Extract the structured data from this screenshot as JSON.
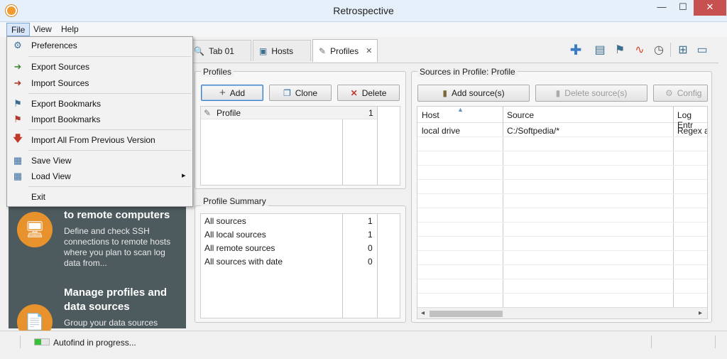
{
  "window": {
    "title": "Retrospective",
    "controls": {
      "minimize": "—",
      "maximize": "☐",
      "close": "✕"
    }
  },
  "menubar": {
    "file": "File",
    "view": "View",
    "help": "Help"
  },
  "file_menu": {
    "items": [
      {
        "label": "Preferences",
        "icon": "gear-icon"
      },
      {
        "label": "Export Sources",
        "icon": "export-sources-icon"
      },
      {
        "label": "Import Sources",
        "icon": "import-sources-icon"
      },
      {
        "label": "Export Bookmarks",
        "icon": "export-bookmarks-icon"
      },
      {
        "label": "Import Bookmarks",
        "icon": "import-bookmarks-icon"
      },
      {
        "label": "Import All From Previous Version",
        "icon": "arrow-down-icon"
      },
      {
        "label": "Save View",
        "icon": "save-view-icon"
      },
      {
        "label": "Load View",
        "icon": "load-view-icon"
      },
      {
        "label": "Exit",
        "icon": ""
      }
    ],
    "submenu_arrow": "▸"
  },
  "tabs": [
    {
      "label": "Tab 01",
      "icon": "search-icon"
    },
    {
      "label": "Hosts",
      "icon": "hosts-icon"
    },
    {
      "label": "Profiles",
      "icon": "profiles-icon",
      "active": true
    }
  ],
  "tab_close": "✕",
  "toolbar_icons": [
    "add-icon",
    "host-add-icon",
    "bookmark-icon",
    "pulse-icon",
    "clock-icon",
    "layout-icon",
    "monitor-icon"
  ],
  "sidebar": {
    "section1": {
      "heading": "to remote computers",
      "body": "Define and check SSH connections to remote hosts where you plan to scan log data from..."
    },
    "section2": {
      "heading": "Manage profiles and data sources",
      "body": "Group your data sources"
    }
  },
  "profiles": {
    "title": "Profiles",
    "buttons": {
      "add": "Add",
      "clone": "Clone",
      "delete": "Delete"
    },
    "rows": [
      {
        "name": "Profile",
        "count": "1"
      }
    ]
  },
  "profile_summary": {
    "title": "Profile Summary",
    "rows": [
      {
        "label": "All sources",
        "value": "1"
      },
      {
        "label": "All local sources",
        "value": "1"
      },
      {
        "label": "All remote sources",
        "value": "0"
      },
      {
        "label": "All sources with date",
        "value": "0"
      }
    ]
  },
  "sources": {
    "title": "Sources in Profile: Profile",
    "buttons": {
      "add": "Add source(s)",
      "delete": "Delete source(s)",
      "config": "Config"
    },
    "columns": [
      "Host",
      "Source",
      "Log Entr"
    ],
    "rows": [
      {
        "host": "local drive",
        "source": "C:/Softpedia/*",
        "log": "Regex at"
      }
    ]
  },
  "status": {
    "text": "Autofind in progress...",
    "progress": 0.45
  },
  "colors": {
    "accent": "#e8922e",
    "sidebar": "#4d5a5e",
    "close": "#c75050",
    "progress": "#3bbf3b"
  }
}
